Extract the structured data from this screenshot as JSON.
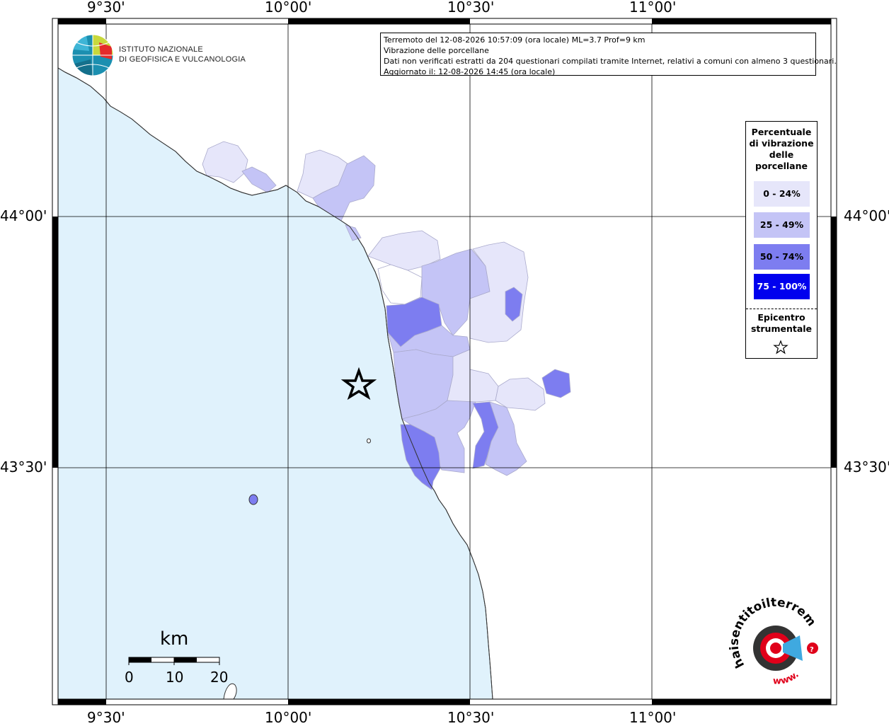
{
  "header": {
    "line1": "Terremoto del 12-08-2026 10:57:09 (ora locale) ML=3.7 Prof=9 km",
    "line2": "Vibrazione delle porcellane",
    "line3": "Dati non verificati estratti da 204 questionari compilati tramite Internet, relativi a comuni con almeno 3 questionari.",
    "line4": "Aggiornato il: 12-08-2026 14:45 (ora locale)"
  },
  "institute": {
    "line1": "ISTITUTO NAZIONALE",
    "line2": "DI GEOFISICA E VULCANOLOGIA"
  },
  "axis_labels": {
    "top": [
      "9°30'",
      "10°00'",
      "10°30'",
      "11°00'"
    ],
    "bottom": [
      "9°30'",
      "10°00'",
      "10°30'",
      "11°00'"
    ],
    "left": [
      "44°00'",
      "43°30'"
    ],
    "right": [
      "44°00'",
      "43°30'"
    ]
  },
  "legend": {
    "title_lines": [
      "Percentuale",
      "di vibrazione",
      "delle",
      "porcellane"
    ],
    "classes": [
      {
        "label": "0 - 24%",
        "color": "#e6e6fa",
        "text_color": "#000000"
      },
      {
        "label": "25 - 49%",
        "color": "#c4c4f6",
        "text_color": "#000000"
      },
      {
        "label": "50 - 74%",
        "color": "#7d7df0",
        "text_color": "#000000"
      },
      {
        "label": "75 - 100%",
        "color": "#0000ee",
        "text_color": "#ffffff"
      }
    ],
    "epicenter_lines": [
      "Epicentro",
      "strumentale"
    ]
  },
  "scale_bar": {
    "unit": "km",
    "ticks": [
      "0",
      "10",
      "20"
    ]
  },
  "badge": {
    "text": "haisentitoilterremoto.it",
    "url_text": "www."
  },
  "colors": {
    "sea": "#e0f2fc",
    "land": "#ffffff",
    "class_0_24": "#e6e6fa",
    "class_25_49": "#c4c4f6",
    "class_50_74": "#7d7df0",
    "class_75_100": "#0000ee",
    "badge_red": "#e0001a"
  }
}
